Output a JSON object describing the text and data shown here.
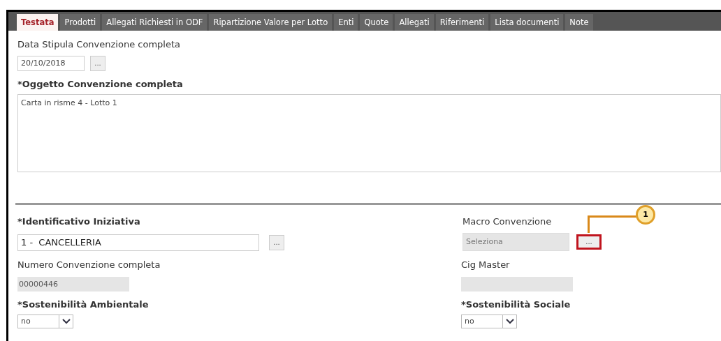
{
  "tabs": [
    {
      "label": "Testata",
      "selected": true
    },
    {
      "label": "Prodotti",
      "selected": false
    },
    {
      "label": "Allegati Richiesti in ODF",
      "selected": false
    },
    {
      "label": "Ripartizione Valore per Lotto",
      "selected": false
    },
    {
      "label": "Enti",
      "selected": false
    },
    {
      "label": "Quote",
      "selected": false
    },
    {
      "label": "Allegati",
      "selected": false
    },
    {
      "label": "Riferimenti",
      "selected": false
    },
    {
      "label": "Lista documenti",
      "selected": false
    },
    {
      "label": "Note",
      "selected": false
    }
  ],
  "data_stipula": {
    "label": "Data Stipula Convenzione completa",
    "bold": false,
    "value": "20/10/2018",
    "button": "..."
  },
  "oggetto": {
    "label": "*Oggetto Convenzione completa",
    "bold": true,
    "value": "Carta in risme 4 - Lotto 1"
  },
  "identificativo": {
    "label": "*Identificativo Iniziativa",
    "bold": true,
    "value": "1 -  CANCELLERIA",
    "button": "..."
  },
  "macro": {
    "label": "Macro Convenzione",
    "bold": false,
    "placeholder": "Seleziona",
    "button": "...",
    "highlighted": true,
    "callout": "1"
  },
  "numero": {
    "label": "Numero Convenzione completa",
    "bold": false,
    "value": "00000446"
  },
  "cig": {
    "label": "Cig Master",
    "bold": false
  },
  "ambientale": {
    "label": "*Sostenibilità Ambientale",
    "bold": true,
    "value": "no"
  },
  "sociale": {
    "label": "*Sostenibilità Sociale",
    "bold": true,
    "value": "no"
  }
}
